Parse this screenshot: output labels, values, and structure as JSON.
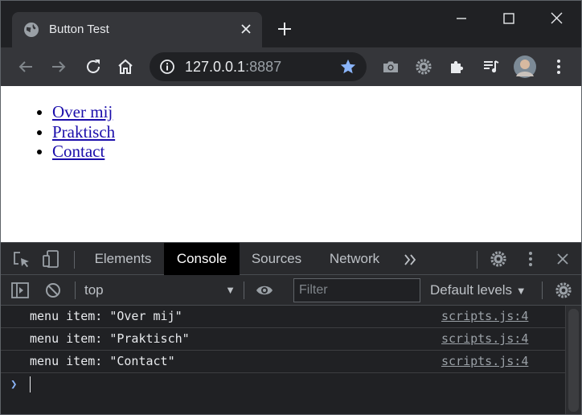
{
  "browser": {
    "tab_title": "Button Test",
    "url_host": "127.0.0.1",
    "url_port": ":8887"
  },
  "page": {
    "links": [
      "Over mij",
      "Praktisch",
      "Contact"
    ]
  },
  "devtools": {
    "tabs": [
      "Elements",
      "Console",
      "Sources",
      "Network"
    ],
    "active_tab": "Console",
    "context": "top",
    "filter_placeholder": "Filter",
    "levels_label": "Default levels",
    "logs": [
      {
        "message": "menu item: \"Over mij\"",
        "source": "scripts.js:4"
      },
      {
        "message": "menu item: \"Praktisch\"",
        "source": "scripts.js:4"
      },
      {
        "message": "menu item: \"Contact\"",
        "source": "scripts.js:4"
      }
    ]
  },
  "colors": {
    "accent": "#8ab4f8",
    "link": "#1a0dab",
    "star": "#8ab4f8"
  },
  "icons": [
    "globe-icon",
    "close-icon",
    "plus-icon",
    "minimize-icon",
    "maximize-icon",
    "back-icon",
    "forward-icon",
    "reload-icon",
    "home-icon",
    "info-icon",
    "star-icon",
    "camera-icon",
    "gear-icon",
    "puzzle-icon",
    "media-icon",
    "avatar",
    "menu-icon",
    "inspect-icon",
    "device-icon",
    "chevron-double-icon",
    "sidebar-icon",
    "block-icon",
    "eye-icon"
  ]
}
